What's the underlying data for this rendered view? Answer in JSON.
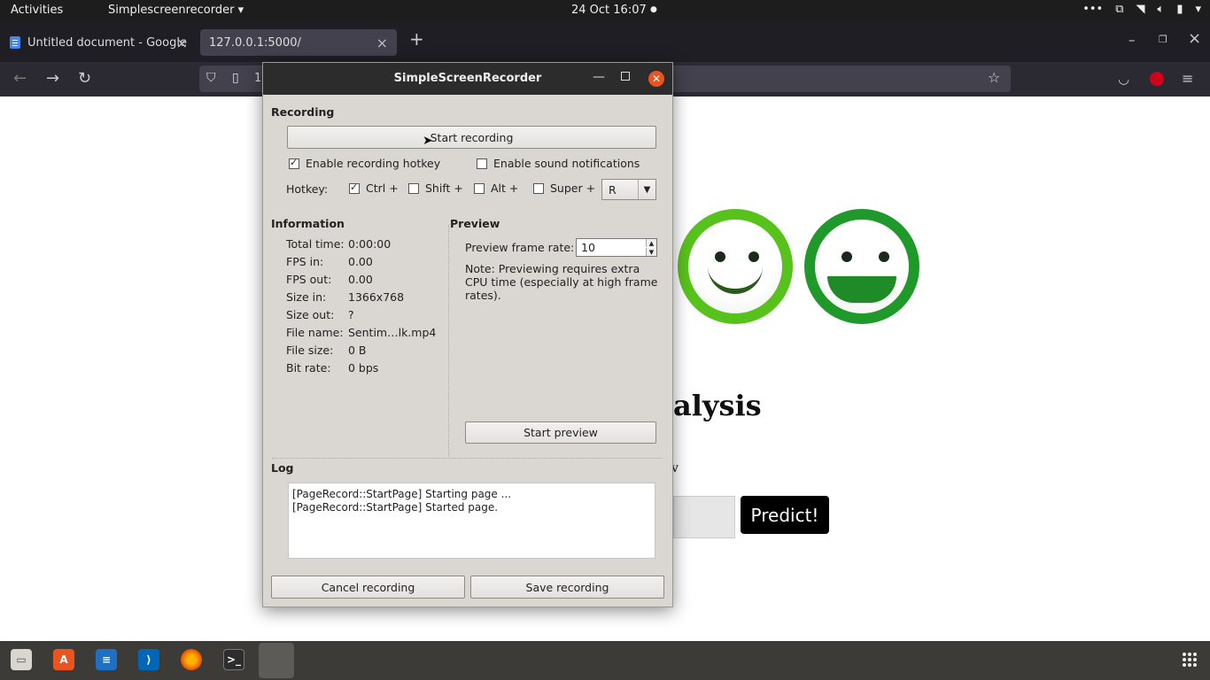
{
  "topbar": {
    "activities": "Activities",
    "app_menu": "Simplescreenrecorder ▾",
    "clock": "24 Oct  16:07"
  },
  "browser": {
    "tabs": [
      {
        "title": "Untitled document - Google"
      },
      {
        "title": "127.0.0.1:5000/"
      }
    ],
    "url_prefix": "1"
  },
  "page": {
    "heading": "alysis",
    "sub": "v",
    "predict_label": "Predict!",
    "smiley_colors": [
      "#58c21c",
      "#1f9a2a"
    ]
  },
  "ssr": {
    "title": "SimpleScreenRecorder",
    "recording": {
      "heading": "Recording",
      "start_label": "Start recording",
      "hotkey_enable_label": "Enable recording hotkey",
      "hotkey_enable_checked": true,
      "sound_label": "Enable sound notifications",
      "sound_checked": false,
      "hotkey_label": "Hotkey:",
      "ctrl": "Ctrl +",
      "shift": "Shift +",
      "alt": "Alt +",
      "super": "Super +",
      "key": "R"
    },
    "info": {
      "heading": "Information",
      "rows": [
        {
          "label": "Total time:",
          "value": "0:00:00"
        },
        {
          "label": "FPS in:",
          "value": "0.00"
        },
        {
          "label": "FPS out:",
          "value": "0.00"
        },
        {
          "label": "Size in:",
          "value": "1366x768"
        },
        {
          "label": "Size out:",
          "value": "?"
        },
        {
          "label": "File name:",
          "value": "Sentim…lk.mp4"
        },
        {
          "label": "File size:",
          "value": "0 B"
        },
        {
          "label": "Bit rate:",
          "value": "0 bps"
        }
      ]
    },
    "preview": {
      "heading": "Preview",
      "rate_label": "Preview frame rate:",
      "rate_value": "10",
      "note": "Note: Previewing requires extra CPU time (especially at high frame rates).",
      "start_label": "Start preview"
    },
    "log": {
      "heading": "Log",
      "lines": [
        "[PageRecord::StartPage] Starting page ...",
        "[PageRecord::StartPage] Started page."
      ]
    },
    "cancel_label": "Cancel recording",
    "save_label": "Save recording"
  },
  "dock": {
    "icons": [
      "files-icon",
      "software-center-icon",
      "writer-icon",
      "vscode-icon",
      "firefox-icon",
      "terminal-icon"
    ]
  }
}
